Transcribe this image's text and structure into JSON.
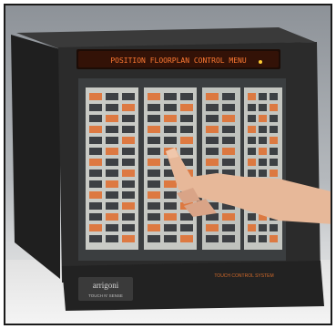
{
  "screen": {
    "title": "POSITION FLOORPLAN CONTROL MENU"
  },
  "brand": {
    "logo": "arrigoni",
    "tagline": "TOUCH N' SENSE"
  },
  "base_label": "TOUCH CONTROL SYSTEM",
  "colors": {
    "console_body": "#2b2b2b",
    "display_glow": "#e05a1e",
    "panel_face": "#c9cbc6",
    "key_dark": "#2e3135",
    "key_orange": "#e16b2a",
    "skin": "#e7b899"
  },
  "panels": [
    {
      "name": "panel-1"
    },
    {
      "name": "panel-2"
    },
    {
      "name": "panel-3"
    },
    {
      "name": "panel-4"
    }
  ]
}
